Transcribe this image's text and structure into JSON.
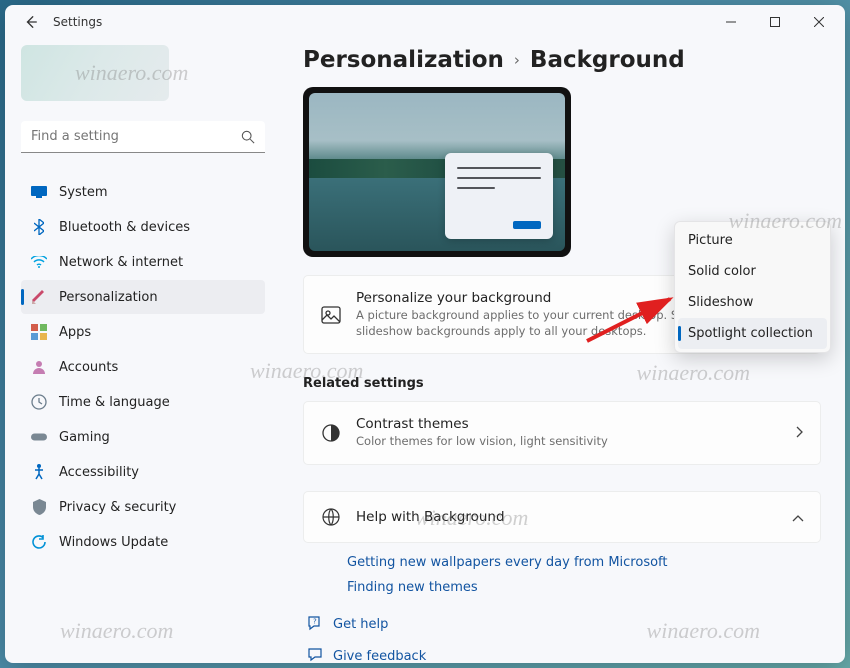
{
  "window": {
    "title": "Settings"
  },
  "search": {
    "placeholder": "Find a setting"
  },
  "nav": [
    {
      "label": "System",
      "icon_color": "#0067c0"
    },
    {
      "label": "Bluetooth & devices",
      "icon_color": "#0067c0"
    },
    {
      "label": "Network & internet",
      "icon_color": "#00a2e0"
    },
    {
      "label": "Personalization",
      "icon_color": "#c94a6b"
    },
    {
      "label": "Apps",
      "icon_color": "#d35d4b"
    },
    {
      "label": "Accounts",
      "icon_color": "#c57db2"
    },
    {
      "label": "Time & language",
      "icon_color": "#6b7d8c"
    },
    {
      "label": "Gaming",
      "icon_color": "#7a8893"
    },
    {
      "label": "Accessibility",
      "icon_color": "#0067c0"
    },
    {
      "label": "Privacy & security",
      "icon_color": "#7a8893"
    },
    {
      "label": "Windows Update",
      "icon_color": "#0091d6"
    }
  ],
  "breadcrumb": {
    "parent": "Personalization",
    "current": "Background"
  },
  "personalize_card": {
    "title": "Personalize your background",
    "desc": "A picture background applies to your current desktop. Solid color or slideshow backgrounds apply to all your desktops."
  },
  "dropdown": {
    "items": [
      "Picture",
      "Solid color",
      "Slideshow",
      "Spotlight collection"
    ],
    "selected_index": 3
  },
  "related_heading": "Related settings",
  "contrast_card": {
    "title": "Contrast themes",
    "desc": "Color themes for low vision, light sensitivity"
  },
  "help_card": {
    "title": "Help with Background"
  },
  "help_links": [
    "Getting new wallpapers every day from Microsoft",
    "Finding new themes"
  ],
  "footer_links": [
    "Get help",
    "Give feedback"
  ],
  "watermark": "winaero.com"
}
